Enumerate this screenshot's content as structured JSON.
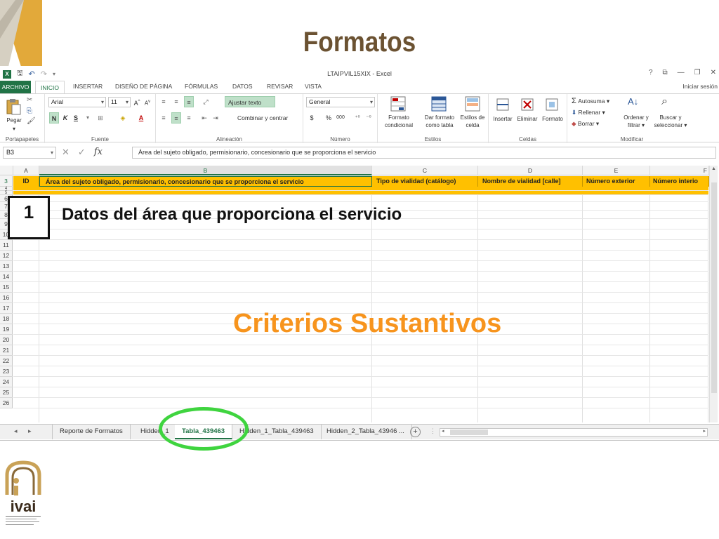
{
  "slide": {
    "title": "Formatos",
    "section_number": "1",
    "section_label": "Datos del área que proporciona el servicio",
    "subtitle": "Criterios Sustantivos",
    "title_color": "#6b5232",
    "subtitle_color": "#f7941d",
    "highlight_color": "#3fd43f"
  },
  "window": {
    "title": "LTAIPVIL15XIX - Excel",
    "controls": [
      "?",
      "⧉",
      "—",
      "❐",
      "✕"
    ],
    "sign_in": "Iniciar sesión"
  },
  "ribbon_tabs": [
    "ARCHIVO",
    "INICIO",
    "INSERTAR",
    "DISEÑO DE PÁGINA",
    "FÓRMULAS",
    "DATOS",
    "REVISAR",
    "VISTA"
  ],
  "ribbon": {
    "portapapeles": {
      "paste": "Pegar",
      "group": "Portapapeles"
    },
    "fuente": {
      "font": "Arial",
      "size": "11",
      "bold": "N",
      "italic": "K",
      "underline": "S",
      "group": "Fuente"
    },
    "alineacion": {
      "wrap": "Ajustar texto",
      "merge": "Combinar y centrar",
      "group": "Alineación"
    },
    "numero": {
      "format": "General",
      "currency": "$",
      "percent": "%",
      "thousands": "000",
      "group": "Número"
    },
    "estilos": {
      "conditional": [
        "Formato",
        "condicional"
      ],
      "as_table": [
        "Dar formato",
        "como tabla"
      ],
      "cell_styles": [
        "Estilos de",
        "celda"
      ],
      "group": "Estilos"
    },
    "celdas": {
      "insert": "Insertar",
      "delete": "Eliminar",
      "format": "Formato",
      "group": "Celdas"
    },
    "modificar": {
      "autosum": "Autosuma",
      "fill": "Rellenar",
      "clear": "Borrar",
      "sort": [
        "Ordenar y",
        "filtrar"
      ],
      "find": [
        "Buscar y",
        "seleccionar"
      ],
      "group": "Modificar"
    }
  },
  "formula_bar": {
    "name_box": "B3",
    "fx": "fx",
    "content": "Área del sujeto obligado, permisionario, concesionario que se proporciona el servicio"
  },
  "grid": {
    "columns": [
      "A",
      "B",
      "C",
      "D",
      "E",
      "F"
    ],
    "header_row_number": "3",
    "headers": [
      "ID",
      "Área del sujeto obligado, permisionario, concesionario que se proporciona el servicio",
      "Tipo de vialidad (catálogo)",
      "Nombre de vialidad [calle]",
      "Número exterior",
      "Número interio"
    ],
    "row_numbers": [
      "4",
      "5",
      "6",
      "7",
      "8",
      "9",
      "10",
      "11",
      "12",
      "13",
      "14",
      "15",
      "16",
      "17",
      "18",
      "19",
      "20",
      "21",
      "22",
      "23",
      "24",
      "25",
      "26"
    ],
    "header_fill": "#ffc000"
  },
  "sheet_tabs": [
    "Reporte de Formatos",
    "Hidden_1",
    "Tabla_439463",
    "Hidden_1_Tabla_439463",
    "Hidden_2_Tabla_43946 ..."
  ],
  "active_sheet": "Tabla_439463",
  "logo": {
    "name": "ivai",
    "caption": "Instituto Veracruzano de Acceso a la Información y Protección de Datos Personales"
  }
}
